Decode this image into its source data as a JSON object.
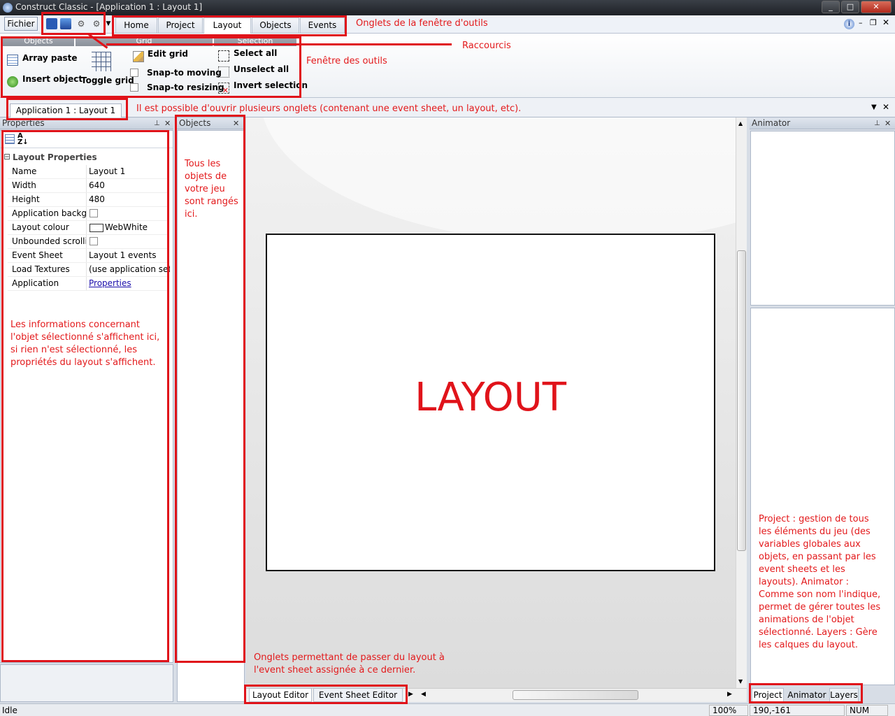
{
  "window": {
    "title": "Construct Classic - [Application 1 : Layout 1]",
    "min": "_",
    "max": "□",
    "close": "✕"
  },
  "toolbar": {
    "file_label": "Fichier",
    "tabs": [
      "Home",
      "Project",
      "Layout",
      "Objects",
      "Events"
    ],
    "active_tab": "Layout",
    "help_glyph": "i"
  },
  "ribbon": {
    "groups": [
      "Objects",
      "Grid",
      "Selection"
    ],
    "objects": {
      "array_paste": "Array paste",
      "insert_object": "Insert object"
    },
    "grid": {
      "toggle_grid": "Toggle grid",
      "edit_grid": "Edit grid",
      "snap_moving": "Snap-to moving",
      "snap_resizing": "Snap-to resizing"
    },
    "selection": {
      "select_all": "Select all",
      "unselect_all": "Unselect all",
      "invert_selection": "Invert selection"
    }
  },
  "document_tab": "Application 1 : Layout 1",
  "properties": {
    "title": "Properties",
    "section": "Layout Properties",
    "rows": [
      {
        "key": "Name",
        "value": "Layout 1"
      },
      {
        "key": "Width",
        "value": "640"
      },
      {
        "key": "Height",
        "value": "480"
      },
      {
        "key": "Application background",
        "value": ""
      },
      {
        "key": "Layout colour",
        "value": "WebWhite"
      },
      {
        "key": "Unbounded scrolling",
        "value": ""
      },
      {
        "key": "Event Sheet",
        "value": "Layout 1 events"
      },
      {
        "key": "Load Textures",
        "value": "(use application settings)"
      },
      {
        "key": "Application",
        "value": "Properties"
      }
    ],
    "colour_swatch": "#ffffff"
  },
  "objects_panel": {
    "title": "Objects"
  },
  "animator_panel": {
    "title": "Animator"
  },
  "editor_tabs": [
    "Layout Editor",
    "Event Sheet Editor"
  ],
  "right_tabs": [
    "Project",
    "Animator",
    "Layers"
  ],
  "layout_label": "LAYOUT",
  "status": {
    "state": "Idle",
    "zoom": "100%",
    "coords": "190,-161",
    "num": "NUM"
  },
  "annotations": {
    "tool_tabs": "Onglets de la fenêtre d'outils",
    "shortcuts": "Raccourcis",
    "tool_window": "Fenêtre des outils",
    "multi_tabs": "Il est possible d'ouvrir plusieurs onglets (contenant une event sheet, un layout, etc).",
    "objects_note": "Tous les objets de votre jeu sont rangés ici.",
    "properties_note": "Les informations concernant l'objet sélectionné s'affichent ici, si rien n'est sélectionné, les propriétés du layout s'affichent.",
    "editor_tabs_note": "Onglets permettant de passer du layout à l'event sheet assignée à ce dernier.",
    "right_note": "Project : gestion de tous les éléments du jeu (des variables globales aux objets, en passant par les event sheets et les layouts). Animator : Comme son nom l'indique, permet de gérer toutes les animations de l'objet sélectionné. Layers : Gère les calques du layout."
  },
  "colors": {
    "annotation_red": "#e0131a",
    "link_blue": "#1a0dab"
  }
}
